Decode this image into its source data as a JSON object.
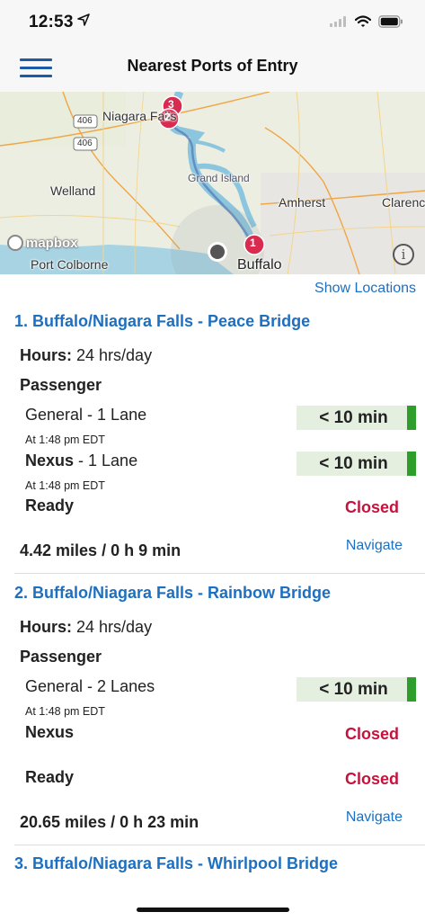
{
  "status_bar": {
    "time": "12:53",
    "location_icon": "location-arrow-icon",
    "signal_icon": "cellular-signal-icon",
    "wifi_icon": "wifi-icon",
    "battery_icon": "battery-icon"
  },
  "nav": {
    "menu_icon": "hamburger-menu-icon",
    "title": "Nearest Ports of Entry"
  },
  "map": {
    "labels": {
      "niagara_falls": "Niagara Falls",
      "welland": "Welland",
      "grand_island": "Grand Island",
      "amherst": "Amherst",
      "clarence": "Clarence",
      "port_colborne": "Port Colborne",
      "buffalo": "Buffalo",
      "highway_1": "406",
      "highway_2": "406"
    },
    "markers": [
      "1",
      "2",
      "3"
    ],
    "attribution": "mapbox",
    "info_label": "i"
  },
  "list": {
    "show_locations": "Show Locations",
    "ports": [
      {
        "title": "1. Buffalo/Niagara Falls - Peace Bridge",
        "hours_label": "Hours:",
        "hours_value": "24 hrs/day",
        "section": "Passenger",
        "lanes": [
          {
            "name": "General",
            "detail": " - 1 Lane",
            "time": "At 1:48 pm EDT",
            "wait": "< 10 min"
          },
          {
            "name": "Nexus",
            "detail": " - 1 Lane",
            "time": "At 1:48 pm EDT",
            "wait": "< 10 min"
          },
          {
            "name": "Ready",
            "status": "Closed"
          }
        ],
        "distance": "4.42 miles / 0 h 9 min",
        "navigate": "Navigate"
      },
      {
        "title": "2. Buffalo/Niagara Falls - Rainbow Bridge",
        "hours_label": "Hours:",
        "hours_value": "24 hrs/day",
        "section": "Passenger",
        "lanes": [
          {
            "name": "General",
            "detail": " - 2 Lanes",
            "time": "At 1:48 pm EDT",
            "wait": "< 10 min"
          },
          {
            "name": "Nexus",
            "status": "Closed"
          },
          {
            "name": "Ready",
            "status": "Closed"
          }
        ],
        "distance": "20.65 miles / 0 h 23 min",
        "navigate": "Navigate"
      },
      {
        "title": "3. Buffalo/Niagara Falls - Whirlpool Bridge"
      }
    ]
  }
}
